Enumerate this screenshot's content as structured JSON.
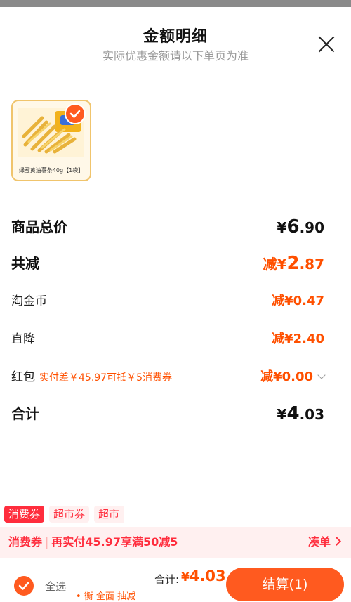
{
  "header": {
    "title": "金额明细",
    "subtitle": "实际优惠金额请以下单页为准"
  },
  "product": {
    "name": "绿蜜黄油薯条40g【1袋】",
    "image_icon": "fries-product-image",
    "selected": true
  },
  "rows": {
    "subtotal": {
      "label": "商品总价",
      "currency": "¥",
      "int": "6",
      "dec": ".90"
    },
    "discount_total": {
      "label": "共减",
      "prefix": "减",
      "currency": "¥",
      "int": "2",
      "dec": ".87"
    },
    "taojin": {
      "label": "淘金币",
      "amount": "减¥0.47"
    },
    "direct": {
      "label": "直降",
      "amount": "减¥2.40"
    },
    "redpacket": {
      "label": "红包",
      "hint": "实付差￥45.97可抵￥5消费券",
      "amount": "减¥0.00"
    },
    "total": {
      "label": "合计",
      "currency": "¥",
      "int": "4",
      "dec": ".03"
    }
  },
  "coupon_tabs": [
    "消费券",
    "超市券",
    "超市"
  ],
  "coupon_bar": {
    "label": "消费券",
    "text": "再实付45.97享满50减5",
    "link": "凑单"
  },
  "bottom": {
    "select_all": "全选",
    "total_label": "合计:",
    "total_currency": "¥",
    "total_value": "4.03",
    "note": "• 衡 全面 抽减 ",
    "checkout": "结算(1)"
  },
  "colors": {
    "accent": "#ff5000",
    "coupon_red": "#ff2d3d",
    "button": "#ff5a1f"
  }
}
